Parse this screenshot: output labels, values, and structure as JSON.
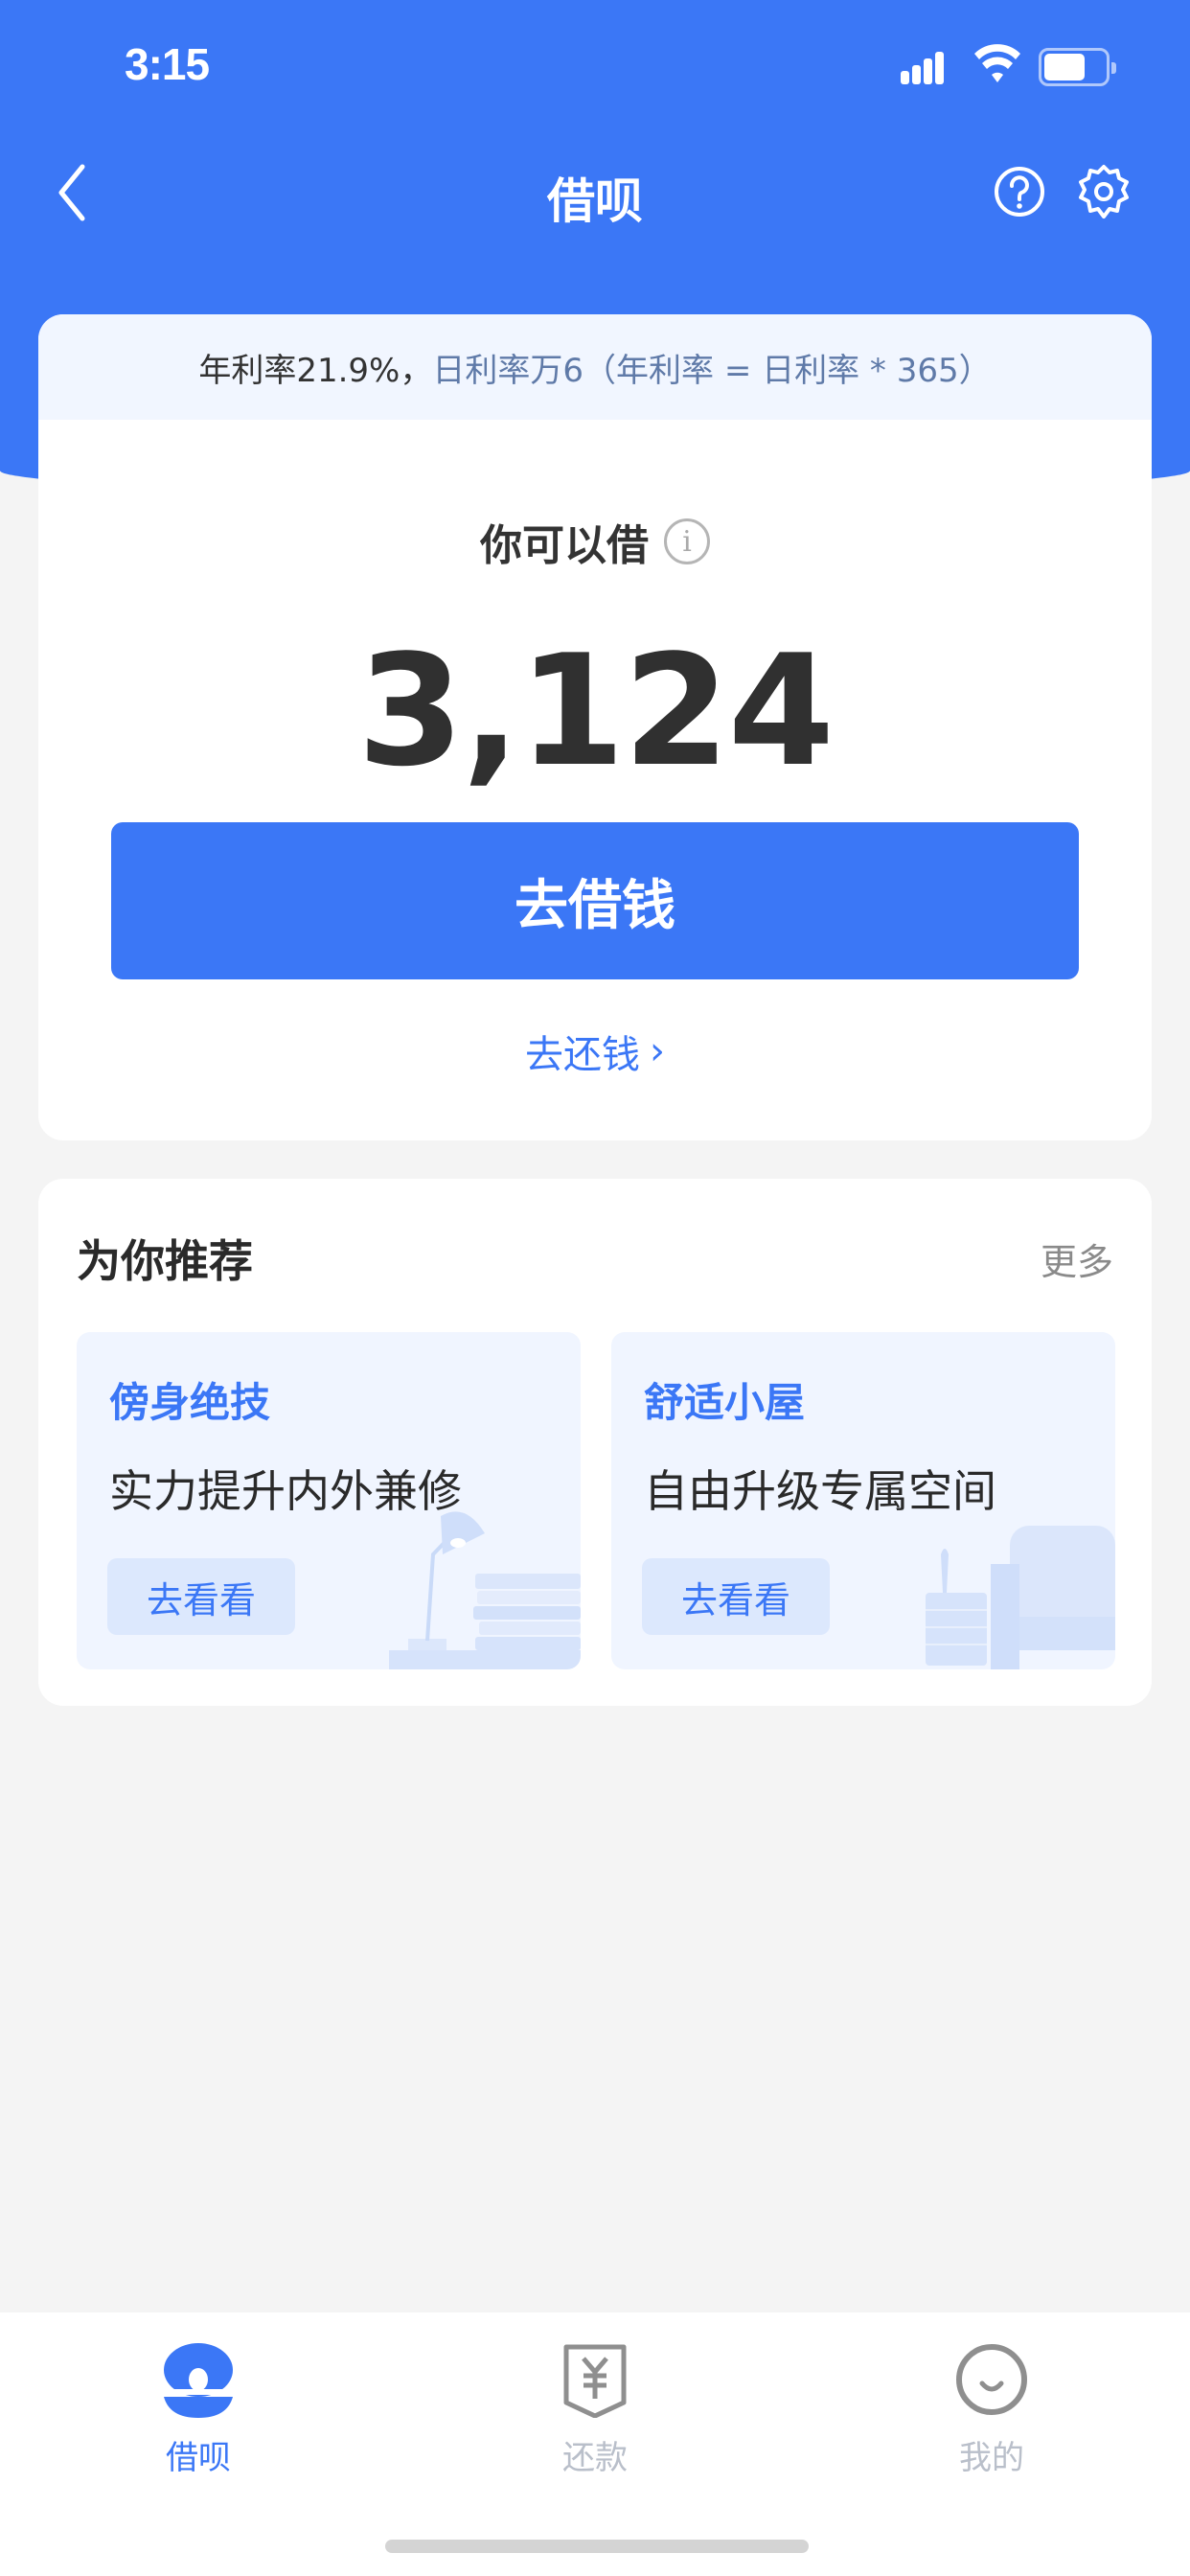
{
  "status_bar": {
    "time": "3:15"
  },
  "nav": {
    "title": "借呗",
    "back_icon": "chevron-left-icon",
    "help_icon": "question-circle-icon",
    "settings_icon": "gear-icon"
  },
  "rate": {
    "annual": "年利率21.9%，",
    "daily": "日利率万6（年利率 = 日利率 * 365）"
  },
  "loan": {
    "label": "你可以借",
    "amount": "3,124",
    "borrow_button": "去借钱",
    "repay_link": "去还钱",
    "repay_chevron": "›"
  },
  "recommend": {
    "title": "为你推荐",
    "more": "更多",
    "cards": [
      {
        "title": "傍身绝技",
        "subtitle": "实力提升内外兼修",
        "button": "去看看"
      },
      {
        "title": "舒适小屋",
        "subtitle": "自由升级专属空间",
        "button": "去看看"
      }
    ]
  },
  "tabbar": {
    "tabs": [
      {
        "label": "借呗",
        "icon": "jiebei-logo-icon",
        "active": true
      },
      {
        "label": "还款",
        "icon": "repay-yen-icon",
        "active": false
      },
      {
        "label": "我的",
        "icon": "smile-profile-icon",
        "active": false
      }
    ]
  },
  "colors": {
    "brand": "#3b77f6",
    "page_bg": "#f4f4f4",
    "rate_bar_bg": "#f1f6ff",
    "inactive_tab": "#b9bfca"
  }
}
